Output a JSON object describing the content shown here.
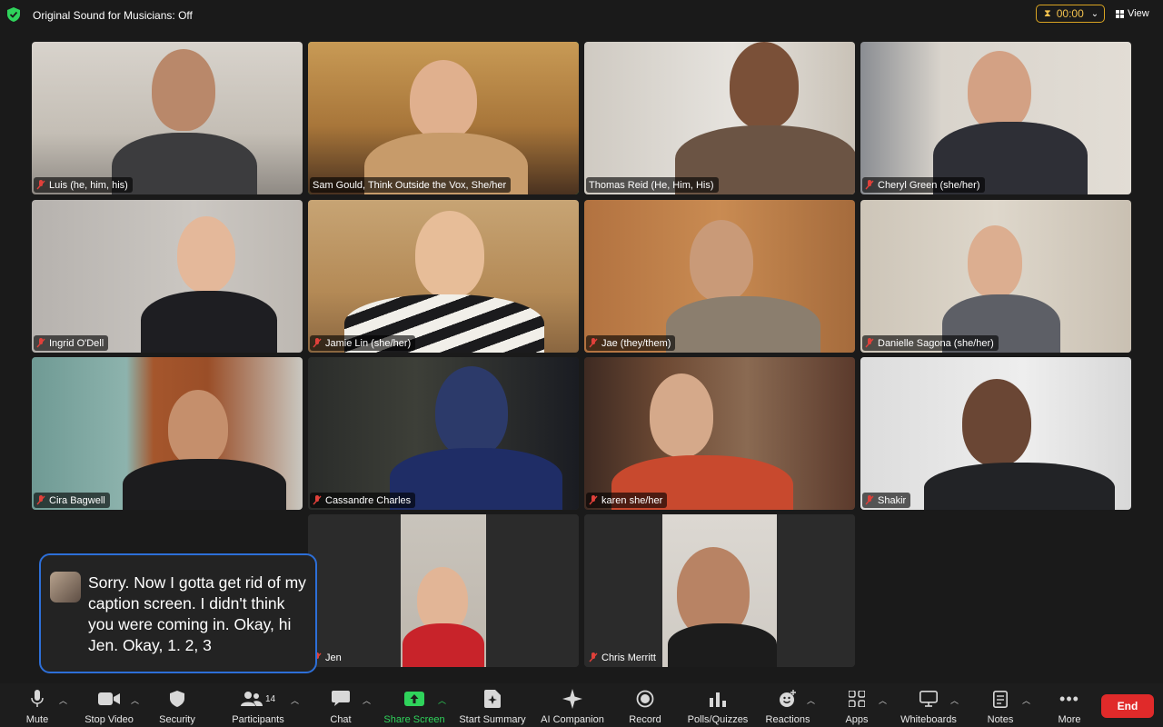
{
  "topbar": {
    "sound_status": "Original Sound for Musicians: Off",
    "timer": "00:00",
    "view_label": "View"
  },
  "participants": [
    {
      "name": "Luis (he, him, his)"
    },
    {
      "name": "Sam Gould, Think Outside the Vox, She/her",
      "active": true
    },
    {
      "name": "Thomas Reid (He, Him, His)"
    },
    {
      "name": "Cheryl Green (she/her)"
    },
    {
      "name": "Ingrid O'Dell"
    },
    {
      "name": "Jamie Lin (she/her)"
    },
    {
      "name": "Jae (they/them)"
    },
    {
      "name": "Danielle Sagona (she/her)"
    },
    {
      "name": "Cira Bagwell"
    },
    {
      "name": "Cassandre Charles"
    },
    {
      "name": "karen she/her"
    },
    {
      "name": "Shakir"
    },
    {
      "name": "Jen"
    },
    {
      "name": "Chris Merritt"
    }
  ],
  "caption": {
    "text": "Sorry. Now I gotta get rid of my caption screen. I didn't think you were coming in. Okay, hi Jen. Okay, 1. 2, 3"
  },
  "toolbar": {
    "mute": "Mute",
    "stop_video": "Stop Video",
    "security": "Security",
    "participants": "Participants",
    "participants_count": "14",
    "chat": "Chat",
    "share_screen": "Share Screen",
    "start_summary": "Start Summary",
    "ai_companion": "AI Companion",
    "record": "Record",
    "polls": "Polls/Quizzes",
    "reactions": "Reactions",
    "apps": "Apps",
    "whiteboards": "Whiteboards",
    "notes": "Notes",
    "more": "More",
    "end": "End"
  },
  "colors": {
    "accent_green": "#2fd35b",
    "caption_border": "#2d6fd8",
    "end_red": "#e02a2a",
    "timer_yellow": "#f2c14e"
  }
}
